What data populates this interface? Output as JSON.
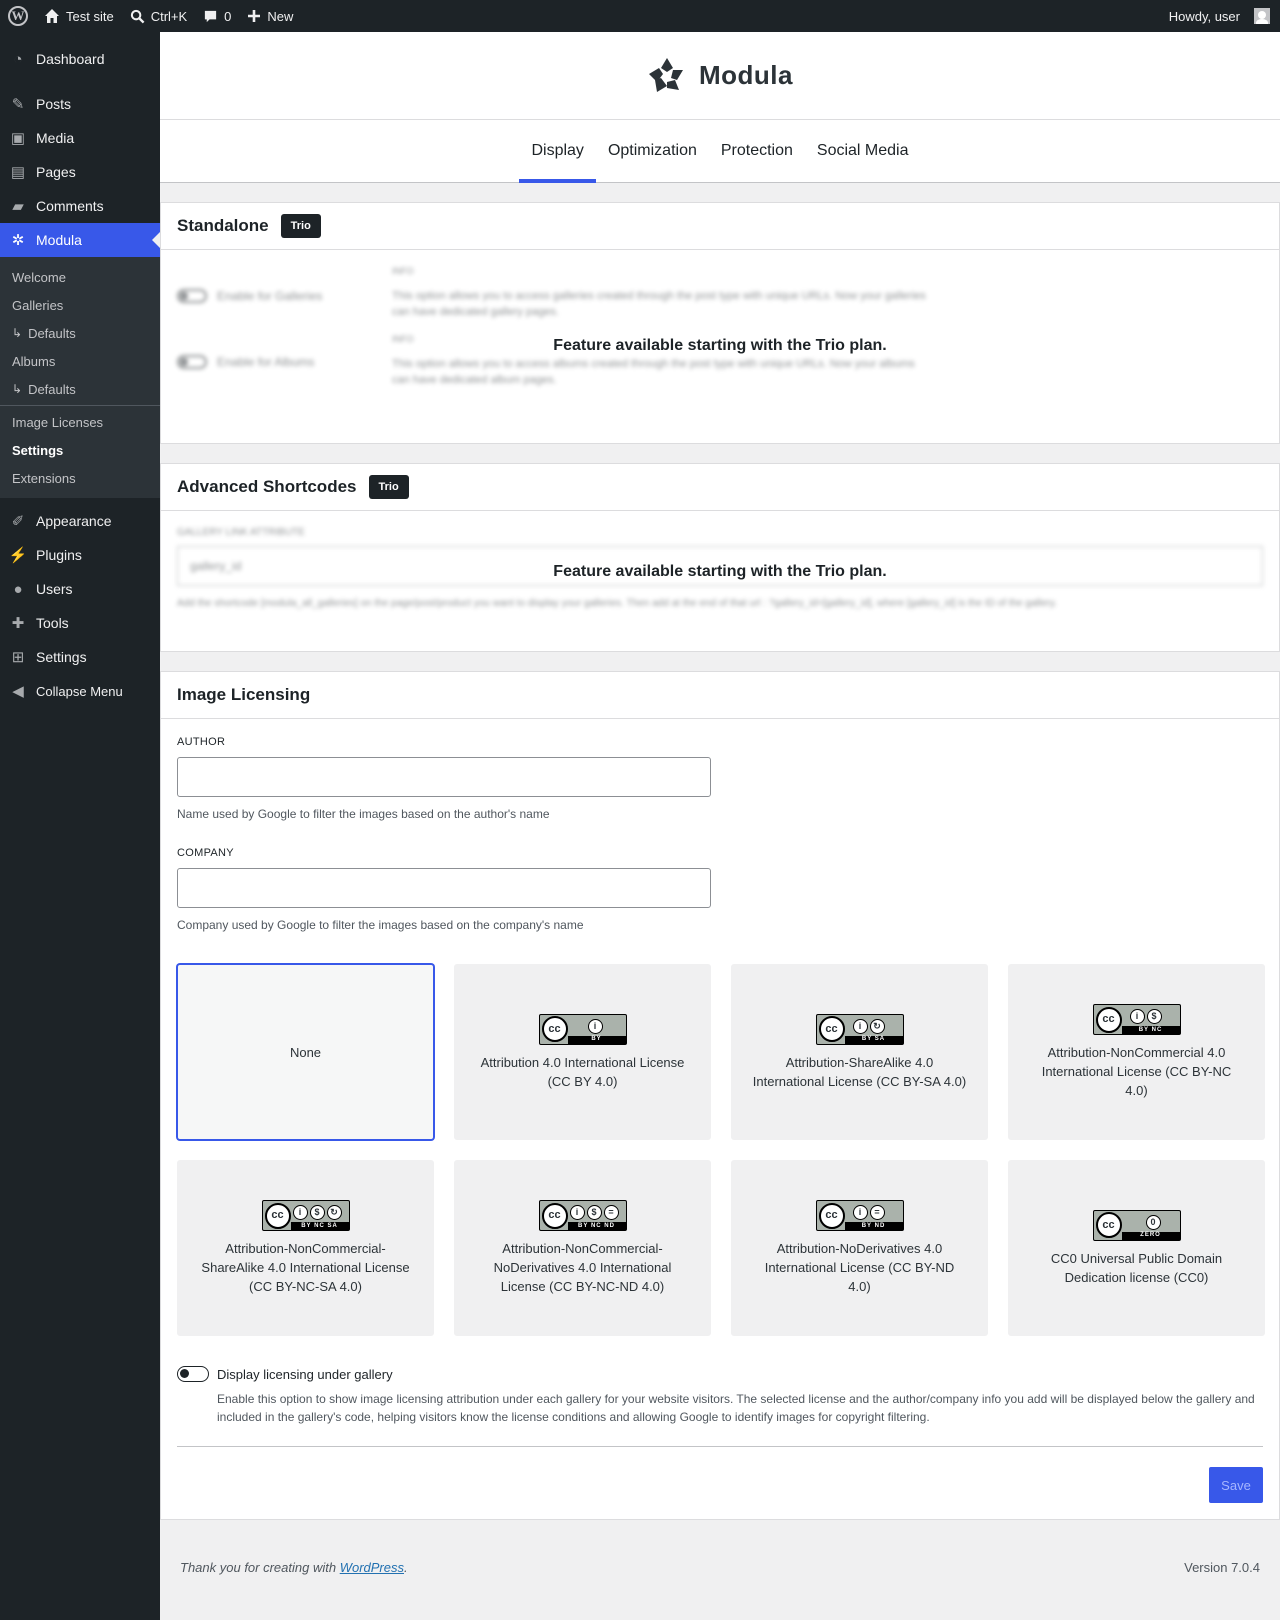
{
  "adminbar": {
    "site_name": "Test site",
    "search_shortcut": "Ctrl+K",
    "comments_count": "0",
    "new_label": "New",
    "howdy": "Howdy, user"
  },
  "sidebar": {
    "items": [
      {
        "label": "Dashboard",
        "icon": "dashboard-icon"
      },
      {
        "label": "Posts",
        "icon": "pin-icon"
      },
      {
        "label": "Media",
        "icon": "media-icon"
      },
      {
        "label": "Pages",
        "icon": "pages-icon"
      },
      {
        "label": "Comments",
        "icon": "comment-icon"
      },
      {
        "label": "Modula",
        "icon": "modula-icon"
      },
      {
        "label": "Appearance",
        "icon": "brush-icon"
      },
      {
        "label": "Plugins",
        "icon": "plug-icon"
      },
      {
        "label": "Users",
        "icon": "user-icon"
      },
      {
        "label": "Tools",
        "icon": "wrench-icon"
      },
      {
        "label": "Settings",
        "icon": "settings-icon"
      },
      {
        "label": "Collapse Menu",
        "icon": "collapse-icon"
      }
    ],
    "submenu": [
      "Welcome",
      "Galleries",
      "Defaults",
      "Albums",
      "Defaults",
      "Image Licenses",
      "Settings",
      "Extensions"
    ]
  },
  "brand": {
    "name": "Modula"
  },
  "tabs": [
    "Display",
    "Optimization",
    "Protection",
    "Social Media"
  ],
  "standalone": {
    "title": "Standalone",
    "badge": "Trio",
    "locked_message": "Feature available starting with the Trio plan.",
    "blurred": {
      "galleries_label": "Enable for Galleries",
      "albums_label": "Enable for Albums",
      "info": "INFO",
      "galleries_desc": "This option allows you to access galleries created through the post type with unique URLs. Now your galleries can have dedicated gallery pages.",
      "albums_desc": "This option allows you to access albums created through the post type with unique URLs. Now your albums can have dedicated album pages."
    }
  },
  "advanced": {
    "title": "Advanced Shortcodes",
    "badge": "Trio",
    "locked_message": "Feature available starting with the Trio plan.",
    "blurred": {
      "label": "GALLERY LINK ATTRIBUTE",
      "value": "gallery_id",
      "desc": "Add the shortcode [modula_all_galleries] on the page/post/product you want to display your galleries. Then add at the end of that url : ?gallery_id=[gallery_id], where [gallery_id] is the ID of the gallery."
    }
  },
  "licensing": {
    "title": "Image Licensing",
    "author_label": "AUTHOR",
    "author_value": "",
    "author_desc": "Name used by Google to filter the images based on the author's name",
    "company_label": "COMPANY",
    "company_value": "",
    "company_desc": "Company used by Google to filter the images based on the company's name",
    "licenses": [
      {
        "label": "None",
        "selected": true
      },
      {
        "label": "Attribution 4.0 International License (CC BY 4.0)",
        "strip": "BY"
      },
      {
        "label": "Attribution-ShareAlike 4.0 International License (CC BY-SA 4.0)",
        "strip": "BY SA"
      },
      {
        "label": "Attribution-NonCommercial 4.0 International License (CC BY-NC 4.0)",
        "strip": "BY NC"
      },
      {
        "label": "Attribution-NonCommercial-ShareAlike 4.0 International License (CC BY-NC-SA 4.0)",
        "strip": "BY NC SA"
      },
      {
        "label": "Attribution-NonCommercial-NoDerivatives 4.0 International License (CC BY-NC-ND 4.0)",
        "strip": "BY NC ND"
      },
      {
        "label": "Attribution-NoDerivatives 4.0 International License (CC BY-ND 4.0)",
        "strip": "BY ND"
      },
      {
        "label": "CC0 Universal Public Domain Dedication license (CC0)",
        "strip": "ZERO"
      }
    ],
    "display_toggle_label": "Display licensing under gallery",
    "display_toggle_on": false,
    "display_toggle_desc": "Enable this option to show image licensing attribution under each gallery for your website visitors. The selected license and the author/company info you add will be displayed below the gallery and included in the gallery's code, helping visitors know the license conditions and allowing Google to identify images for copyright filtering.",
    "save_label": "Save"
  },
  "footer": {
    "thanks": "Thank you for creating with ",
    "link": "WordPress",
    "period": ".",
    "version": "Version 7.0.4"
  },
  "colors": {
    "accent": "#3858e9",
    "adminbar": "#1d2327"
  }
}
